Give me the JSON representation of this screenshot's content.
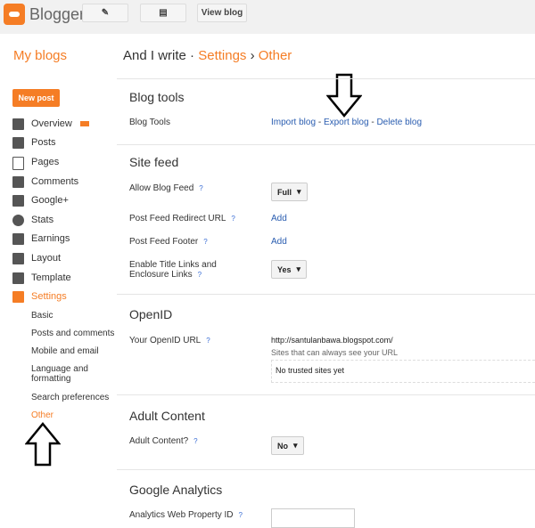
{
  "header": {
    "brand": "Blogger",
    "view_blog": "View blog"
  },
  "breadcrumb": {
    "my_blogs": "My blogs",
    "blog": "And I write",
    "sep1": "·",
    "settings": "Settings",
    "sep2": "›",
    "current": "Other"
  },
  "sidebar": {
    "new_post": "New post",
    "items": [
      {
        "label": "Overview",
        "icon": "home-icon"
      },
      {
        "label": "Posts",
        "icon": "posts-icon"
      },
      {
        "label": "Pages",
        "icon": "pages-icon"
      },
      {
        "label": "Comments",
        "icon": "comment-icon"
      },
      {
        "label": "Google+",
        "icon": "google-plus-icon"
      },
      {
        "label": "Stats",
        "icon": "pie-chart-icon"
      },
      {
        "label": "Earnings",
        "icon": "trophy-icon"
      },
      {
        "label": "Layout",
        "icon": "layout-icon"
      },
      {
        "label": "Template",
        "icon": "paint-roller-icon"
      },
      {
        "label": "Settings",
        "icon": "wrench-icon"
      }
    ],
    "subitems": [
      "Basic",
      "Posts and comments",
      "Mobile and email",
      "Language and formatting",
      "Search preferences",
      "Other"
    ]
  },
  "sections": {
    "blog_tools": {
      "title": "Blog tools",
      "label": "Blog Tools",
      "import": "Import blog",
      "export": "Export blog",
      "delete": "Delete blog",
      "dash": "-"
    },
    "site_feed": {
      "title": "Site feed",
      "allow_label": "Allow Blog Feed",
      "allow_value": "Full",
      "redirect_label": "Post Feed Redirect URL",
      "redirect_link": "Add",
      "footer_label": "Post Feed Footer",
      "footer_link": "Add",
      "title_links_label": "Enable Title Links and Enclosure Links",
      "title_links_value": "Yes"
    },
    "openid": {
      "title": "OpenID",
      "label": "Your OpenID URL",
      "url": "http://santulanbawa.blogspot.com/",
      "trusted_label": "Sites that can always see your URL",
      "trusted_value": "No trusted sites yet"
    },
    "adult": {
      "title": "Adult Content",
      "label": "Adult Content?",
      "value": "No"
    },
    "analytics": {
      "title": "Google Analytics",
      "label": "Analytics Web Property ID"
    }
  },
  "help_mark": "?",
  "colors": {
    "accent": "#f57d25",
    "link": "#2a5db0"
  }
}
